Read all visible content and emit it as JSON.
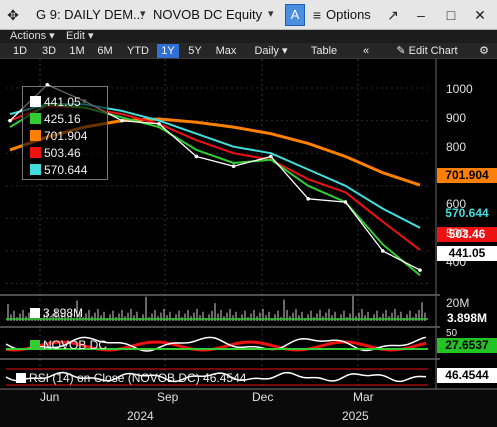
{
  "titlebar": {
    "move_glyph": "✥",
    "title": "G 9: DAILY DEM...",
    "ticker": "NOVOB DC Equity",
    "a_label": "A",
    "options_label": "Options",
    "window_buttons": [
      "↗",
      "–",
      "□",
      "✕"
    ]
  },
  "menu": {
    "actions": "Actions",
    "edit": "Edit"
  },
  "toolbar": {
    "ranges": [
      "1D",
      "3D",
      "1M",
      "6M",
      "YTD",
      "1Y",
      "5Y",
      "Max"
    ],
    "selected_range": "1Y",
    "period": "Daily",
    "table": "Table",
    "edit_chart": "Edit Chart",
    "collapse_glyph": "«",
    "settings_glyph": "⚙"
  },
  "legend": [
    {
      "value": "441.05",
      "color": "#ffffff"
    },
    {
      "value": "425.16",
      "color": "#33cc33"
    },
    {
      "value": "701.904",
      "color": "#ff7f00"
    },
    {
      "value": "503.46",
      "color": "#ee1111"
    },
    {
      "value": "570.644",
      "color": "#44dddd"
    }
  ],
  "right_labels": [
    {
      "text": "701.904",
      "bg": "#ff7f00",
      "fg": "#000000"
    },
    {
      "text": "570.644",
      "bg": "#000000",
      "fg": "#44dddd"
    },
    {
      "text": "503.46",
      "bg": "#ee1111",
      "fg": "#ffffff"
    },
    {
      "text": "441.05",
      "bg": "#ffffff",
      "fg": "#000000"
    }
  ],
  "yaxis_price": [
    "1000",
    "900",
    "800",
    "600",
    "500",
    "400"
  ],
  "volume": {
    "legend": "3.898M",
    "axis": "20M",
    "label": "3.898M"
  },
  "relative": {
    "legend": "NOVOB DC",
    "label": "27.6537",
    "axis": "50"
  },
  "rsi": {
    "legend": "RSI (14)  on Close (NOVOB DC) 46.4544",
    "label": "46.4544"
  },
  "xaxis": {
    "months": [
      "Jun",
      "Sep",
      "Dec",
      "Mar"
    ],
    "years": [
      "2024",
      "2025"
    ]
  },
  "colors": {
    "accent": "#2f6fd6",
    "price": "#ffffff",
    "ma_short": "#33cc33",
    "ma_long": "#ff7f00",
    "ma_mid": "#ee1111",
    "ma_cyan": "#44dddd"
  },
  "chart_data": {
    "type": "line",
    "title": "",
    "xlabel": "",
    "ylabel": "",
    "ylim": [
      380,
      1080
    ],
    "x": [
      "May-24",
      "Jun-24",
      "Jul-24",
      "Aug-24",
      "Sep-24",
      "Oct-24",
      "Nov-24",
      "Dec-24",
      "Jan-25",
      "Feb-25",
      "Mar-25",
      "Apr-25"
    ],
    "series": [
      {
        "name": "",
        "values": [
          900,
          1010,
          960,
          900,
          890,
          790,
          760,
          790,
          660,
          650,
          500,
          441
        ]
      },
      {
        "name": "",
        "values": [
          880,
          950,
          940,
          910,
          880,
          810,
          770,
          780,
          700,
          650,
          520,
          425
        ]
      },
      {
        "name": "",
        "values": [
          810,
          850,
          880,
          900,
          905,
          895,
          880,
          860,
          830,
          790,
          740,
          702
        ]
      },
      {
        "name": "",
        "values": [
          900,
          945,
          940,
          920,
          890,
          840,
          800,
          780,
          720,
          680,
          590,
          503
        ]
      },
      {
        "name": "",
        "values": [
          920,
          950,
          950,
          930,
          900,
          860,
          820,
          800,
          750,
          700,
          630,
          571
        ]
      }
    ]
  }
}
